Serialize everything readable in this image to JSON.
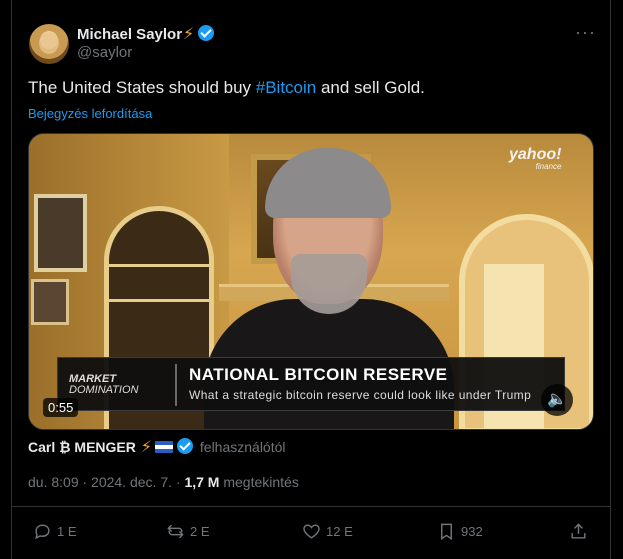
{
  "author": {
    "name": "Michael Saylor",
    "handle": "@saylor",
    "verified": true
  },
  "more_label": "···",
  "post": {
    "text_before": "The United States should buy ",
    "hashtag": "#Bitcoin",
    "text_after": " and sell Gold.",
    "translate_label": "Bejegyzés lefordítása"
  },
  "video": {
    "brand": "yahoo!",
    "brand_sub": "finance",
    "show_line1": "MARKET",
    "show_line2": "DOMINATION",
    "headline": "NATIONAL BITCOIN RESERVE",
    "subheadline": "What a strategic bitcoin reserve could look like under Trump",
    "duration": "0:55"
  },
  "attribution": {
    "name": "Carl ₿ MENGER",
    "suffix": "felhasználótól"
  },
  "meta": {
    "time": "du. 8:09 · 2024. dec. 7. · ",
    "views": "1,7 M",
    "views_label": " megtekintés"
  },
  "actions": {
    "replies": "1 E",
    "reposts": "2 E",
    "likes": "12 E",
    "bookmarks": "932"
  },
  "colors": {
    "accent": "#1d9bf0",
    "muted": "#71767b",
    "background": "#000000"
  }
}
